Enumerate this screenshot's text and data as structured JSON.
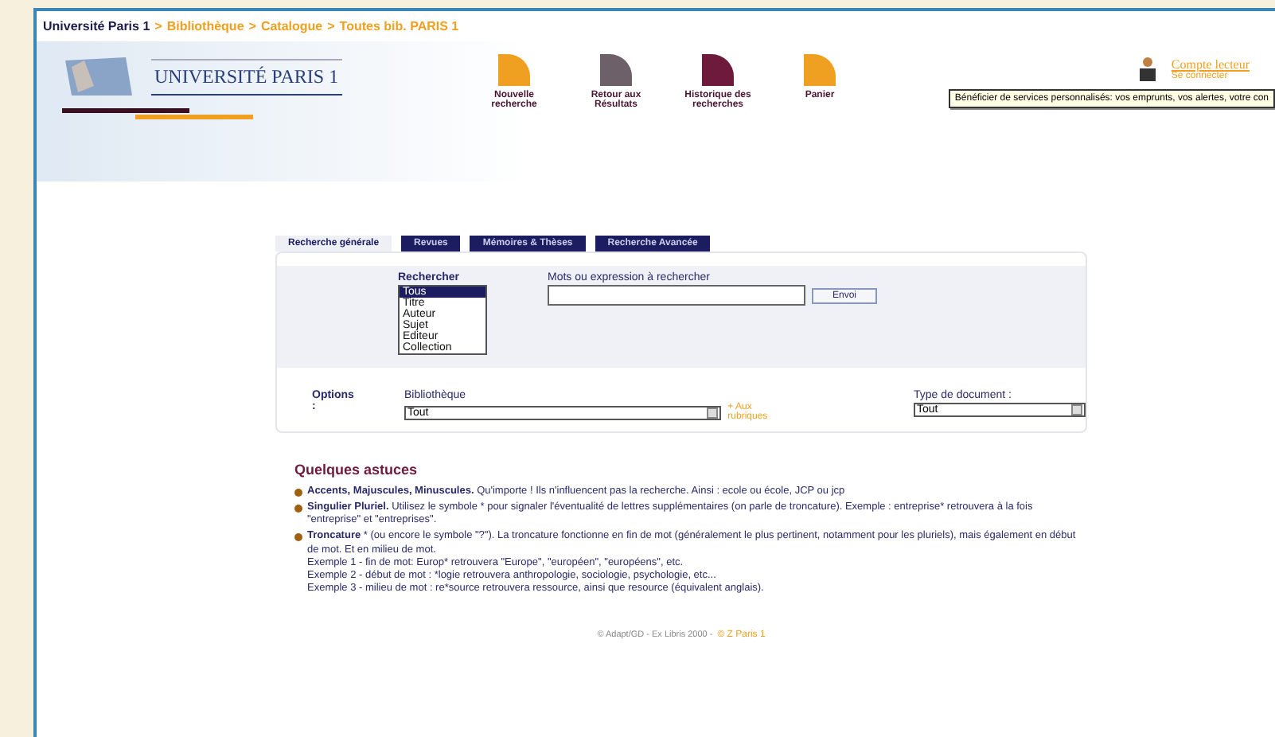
{
  "breadcrumb": [
    {
      "label": "Université Paris 1",
      "kind": "home"
    },
    {
      "label": ">",
      "kind": "sep"
    },
    {
      "label": "Bibliothèque",
      "kind": "link"
    },
    {
      "label": ">",
      "kind": "sep"
    },
    {
      "label": "Catalogue",
      "kind": "link"
    },
    {
      "label": ">",
      "kind": "sep"
    },
    {
      "label": "Toutes bib. PARIS 1",
      "kind": "link"
    }
  ],
  "logo": {
    "text": "UNIVERSITÉ PARIS 1"
  },
  "nav": [
    {
      "label": "Nouvelle recherche",
      "color": "#f0a020"
    },
    {
      "label": "Retour aux Résultats",
      "color": "#6e6068"
    },
    {
      "label": "Historique des recherches",
      "color": "#6e1a3c"
    },
    {
      "label": "Panier",
      "color": "#f0a020"
    }
  ],
  "account": {
    "title": "Compte lecteur",
    "link": "Se connecter",
    "tooltip": "Bénéficier de services personnalisés: vos emprunts, vos alertes, votre con"
  },
  "tabs": [
    {
      "label": "Recherche générale",
      "selected": true
    },
    {
      "label": "Revues",
      "selected": false
    },
    {
      "label": "Mémoires & Thèses",
      "selected": false
    },
    {
      "label": "Recherche Avancée",
      "selected": false
    }
  ],
  "search": {
    "scope_label": "Rechercher",
    "scopes": [
      {
        "label": "Tous",
        "selected": true
      },
      {
        "label": "Titre",
        "selected": false
      },
      {
        "label": "Auteur",
        "selected": false
      },
      {
        "label": "Sujet",
        "selected": false
      },
      {
        "label": "Editeur",
        "selected": false
      },
      {
        "label": "Collection",
        "selected": false
      }
    ],
    "query_label": "Mots ou expression à rechercher",
    "submit": "Envoi"
  },
  "options": {
    "label": "Options :",
    "library_label": "Bibliothèque",
    "library_value": "Tout",
    "library_link": "+ Aux rubriques",
    "doctype_label": "Type de document :",
    "doctype_value": "Tout"
  },
  "tips": {
    "title": "Quelques astuces",
    "items": [
      {
        "lead": "Accents, Majuscules, Minuscules.",
        "lines": [
          "Qu'importe ! Ils n'influencent pas la recherche. Ainsi : ecole ou école, JCP ou jcp"
        ]
      },
      {
        "lead": "Singulier Pluriel.",
        "lines": [
          "Utilisez le symbole * pour signaler l'éventualité de lettres supplémentaires (on parle de troncature). Exemple : entreprise* retrouvera à la fois \"entreprise\" et \"entreprises\"."
        ]
      },
      {
        "lead": "Troncature",
        "lines": [
          "* (ou encore le symbole \"?\"). La troncature fonctionne en fin de mot (généralement le plus pertinent, notamment pour les pluriels), mais également en début de mot. Et en milieu de mot.",
          "Exemple 1 - fin de mot: Europ* retrouvera \"Europe\", \"européen\", \"européens\", etc.",
          "Exemple 2 - début de mot : *logie retrouvera anthropologie, sociologie, psychologie, etc...",
          "Exemple 3 - milieu de mot : re*source retrouvera ressource, ainsi que resource (équivalent anglais)."
        ]
      }
    ]
  },
  "footer": {
    "text": "© Adapt/GD - Ex Libris 2000 -",
    "link": "© Z Paris 1"
  }
}
